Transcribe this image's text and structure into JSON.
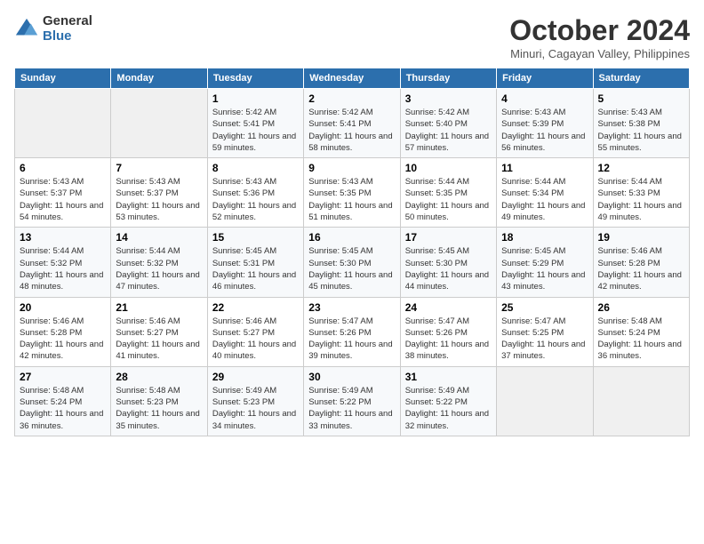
{
  "logo": {
    "line1": "General",
    "line2": "Blue"
  },
  "title": "October 2024",
  "subtitle": "Minuri, Cagayan Valley, Philippines",
  "days_header": [
    "Sunday",
    "Monday",
    "Tuesday",
    "Wednesday",
    "Thursday",
    "Friday",
    "Saturday"
  ],
  "weeks": [
    [
      {
        "num": "",
        "sunrise": "",
        "sunset": "",
        "daylight": ""
      },
      {
        "num": "",
        "sunrise": "",
        "sunset": "",
        "daylight": ""
      },
      {
        "num": "1",
        "sunrise": "Sunrise: 5:42 AM",
        "sunset": "Sunset: 5:41 PM",
        "daylight": "Daylight: 11 hours and 59 minutes."
      },
      {
        "num": "2",
        "sunrise": "Sunrise: 5:42 AM",
        "sunset": "Sunset: 5:41 PM",
        "daylight": "Daylight: 11 hours and 58 minutes."
      },
      {
        "num": "3",
        "sunrise": "Sunrise: 5:42 AM",
        "sunset": "Sunset: 5:40 PM",
        "daylight": "Daylight: 11 hours and 57 minutes."
      },
      {
        "num": "4",
        "sunrise": "Sunrise: 5:43 AM",
        "sunset": "Sunset: 5:39 PM",
        "daylight": "Daylight: 11 hours and 56 minutes."
      },
      {
        "num": "5",
        "sunrise": "Sunrise: 5:43 AM",
        "sunset": "Sunset: 5:38 PM",
        "daylight": "Daylight: 11 hours and 55 minutes."
      }
    ],
    [
      {
        "num": "6",
        "sunrise": "Sunrise: 5:43 AM",
        "sunset": "Sunset: 5:37 PM",
        "daylight": "Daylight: 11 hours and 54 minutes."
      },
      {
        "num": "7",
        "sunrise": "Sunrise: 5:43 AM",
        "sunset": "Sunset: 5:37 PM",
        "daylight": "Daylight: 11 hours and 53 minutes."
      },
      {
        "num": "8",
        "sunrise": "Sunrise: 5:43 AM",
        "sunset": "Sunset: 5:36 PM",
        "daylight": "Daylight: 11 hours and 52 minutes."
      },
      {
        "num": "9",
        "sunrise": "Sunrise: 5:43 AM",
        "sunset": "Sunset: 5:35 PM",
        "daylight": "Daylight: 11 hours and 51 minutes."
      },
      {
        "num": "10",
        "sunrise": "Sunrise: 5:44 AM",
        "sunset": "Sunset: 5:35 PM",
        "daylight": "Daylight: 11 hours and 50 minutes."
      },
      {
        "num": "11",
        "sunrise": "Sunrise: 5:44 AM",
        "sunset": "Sunset: 5:34 PM",
        "daylight": "Daylight: 11 hours and 49 minutes."
      },
      {
        "num": "12",
        "sunrise": "Sunrise: 5:44 AM",
        "sunset": "Sunset: 5:33 PM",
        "daylight": "Daylight: 11 hours and 49 minutes."
      }
    ],
    [
      {
        "num": "13",
        "sunrise": "Sunrise: 5:44 AM",
        "sunset": "Sunset: 5:32 PM",
        "daylight": "Daylight: 11 hours and 48 minutes."
      },
      {
        "num": "14",
        "sunrise": "Sunrise: 5:44 AM",
        "sunset": "Sunset: 5:32 PM",
        "daylight": "Daylight: 11 hours and 47 minutes."
      },
      {
        "num": "15",
        "sunrise": "Sunrise: 5:45 AM",
        "sunset": "Sunset: 5:31 PM",
        "daylight": "Daylight: 11 hours and 46 minutes."
      },
      {
        "num": "16",
        "sunrise": "Sunrise: 5:45 AM",
        "sunset": "Sunset: 5:30 PM",
        "daylight": "Daylight: 11 hours and 45 minutes."
      },
      {
        "num": "17",
        "sunrise": "Sunrise: 5:45 AM",
        "sunset": "Sunset: 5:30 PM",
        "daylight": "Daylight: 11 hours and 44 minutes."
      },
      {
        "num": "18",
        "sunrise": "Sunrise: 5:45 AM",
        "sunset": "Sunset: 5:29 PM",
        "daylight": "Daylight: 11 hours and 43 minutes."
      },
      {
        "num": "19",
        "sunrise": "Sunrise: 5:46 AM",
        "sunset": "Sunset: 5:28 PM",
        "daylight": "Daylight: 11 hours and 42 minutes."
      }
    ],
    [
      {
        "num": "20",
        "sunrise": "Sunrise: 5:46 AM",
        "sunset": "Sunset: 5:28 PM",
        "daylight": "Daylight: 11 hours and 42 minutes."
      },
      {
        "num": "21",
        "sunrise": "Sunrise: 5:46 AM",
        "sunset": "Sunset: 5:27 PM",
        "daylight": "Daylight: 11 hours and 41 minutes."
      },
      {
        "num": "22",
        "sunrise": "Sunrise: 5:46 AM",
        "sunset": "Sunset: 5:27 PM",
        "daylight": "Daylight: 11 hours and 40 minutes."
      },
      {
        "num": "23",
        "sunrise": "Sunrise: 5:47 AM",
        "sunset": "Sunset: 5:26 PM",
        "daylight": "Daylight: 11 hours and 39 minutes."
      },
      {
        "num": "24",
        "sunrise": "Sunrise: 5:47 AM",
        "sunset": "Sunset: 5:26 PM",
        "daylight": "Daylight: 11 hours and 38 minutes."
      },
      {
        "num": "25",
        "sunrise": "Sunrise: 5:47 AM",
        "sunset": "Sunset: 5:25 PM",
        "daylight": "Daylight: 11 hours and 37 minutes."
      },
      {
        "num": "26",
        "sunrise": "Sunrise: 5:48 AM",
        "sunset": "Sunset: 5:24 PM",
        "daylight": "Daylight: 11 hours and 36 minutes."
      }
    ],
    [
      {
        "num": "27",
        "sunrise": "Sunrise: 5:48 AM",
        "sunset": "Sunset: 5:24 PM",
        "daylight": "Daylight: 11 hours and 36 minutes."
      },
      {
        "num": "28",
        "sunrise": "Sunrise: 5:48 AM",
        "sunset": "Sunset: 5:23 PM",
        "daylight": "Daylight: 11 hours and 35 minutes."
      },
      {
        "num": "29",
        "sunrise": "Sunrise: 5:49 AM",
        "sunset": "Sunset: 5:23 PM",
        "daylight": "Daylight: 11 hours and 34 minutes."
      },
      {
        "num": "30",
        "sunrise": "Sunrise: 5:49 AM",
        "sunset": "Sunset: 5:22 PM",
        "daylight": "Daylight: 11 hours and 33 minutes."
      },
      {
        "num": "31",
        "sunrise": "Sunrise: 5:49 AM",
        "sunset": "Sunset: 5:22 PM",
        "daylight": "Daylight: 11 hours and 32 minutes."
      },
      {
        "num": "",
        "sunrise": "",
        "sunset": "",
        "daylight": ""
      },
      {
        "num": "",
        "sunrise": "",
        "sunset": "",
        "daylight": ""
      }
    ]
  ]
}
